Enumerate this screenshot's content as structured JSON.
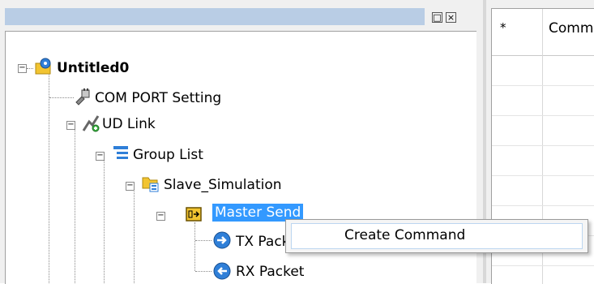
{
  "window": {
    "left_pane_controls": [
      "□",
      "×"
    ]
  },
  "tree": {
    "root": {
      "label": "Untitled0",
      "expander": "−"
    },
    "com_port": {
      "label": "COM PORT Setting"
    },
    "ud_link": {
      "label": "UD Link",
      "expander": "−"
    },
    "group_list": {
      "label": "Group List",
      "expander": "−"
    },
    "slave_sim": {
      "label": "Slave_Simulation",
      "expander": "−"
    },
    "master_send": {
      "label": "Master Send",
      "expander": "−",
      "selected": true
    },
    "tx_packet": {
      "label": "TX Packet"
    },
    "rx_packet": {
      "label": "RX Packet"
    }
  },
  "grid": {
    "col1_header": "*",
    "col2_header": "Comm"
  },
  "context_menu": {
    "items": [
      "Create Command"
    ]
  },
  "colors": {
    "selection": "#3399ff",
    "titlebar": "#b9cde5",
    "icon_blue": "#2f7fd8",
    "icon_yellow": "#f2c431"
  }
}
